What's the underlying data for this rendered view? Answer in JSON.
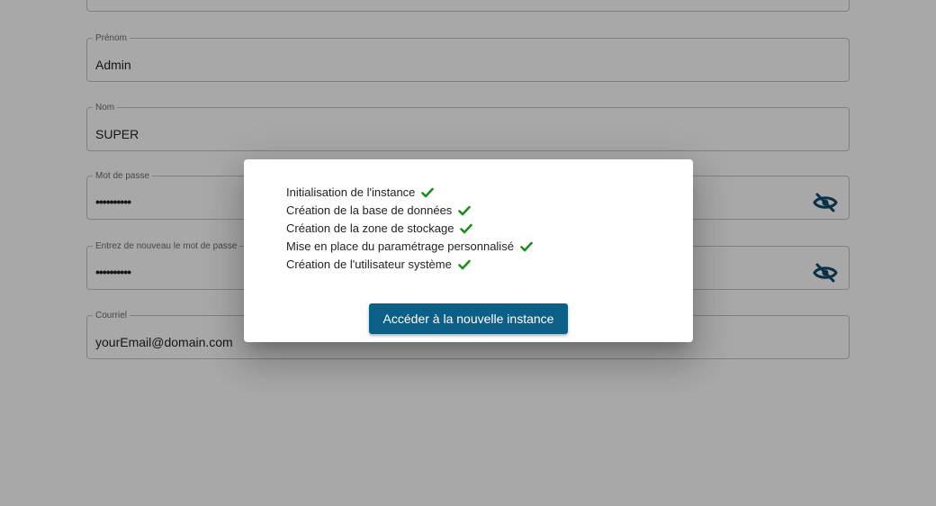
{
  "form": {
    "fields": [
      {
        "label": "",
        "value": ""
      },
      {
        "label": "Prénom",
        "value": "Admin"
      },
      {
        "label": "Nom",
        "value": "SUPER"
      },
      {
        "label": "Mot de passe",
        "value": "••••••••••"
      },
      {
        "label": "Entrez de nouveau le mot de passe",
        "value": "••••••••••"
      },
      {
        "label": "Courriel",
        "value": "yourEmail@domain.com"
      }
    ],
    "password_toggle_icon": "eye-off-icon"
  },
  "dialog": {
    "steps": [
      {
        "label": "Initialisation de l'instance",
        "status": "done"
      },
      {
        "label": "Création de la base de données",
        "status": "done"
      },
      {
        "label": "Création de la zone de stockage",
        "status": "done"
      },
      {
        "label": "Mise en place du paramétrage personnalisé",
        "status": "done"
      },
      {
        "label": "Création de l'utilisateur système",
        "status": "done"
      }
    ],
    "check_icon": "checkmark-icon",
    "button_label": "Accéder à la nouvelle instance"
  },
  "colors": {
    "primary": "#0c5f87",
    "success": "#1e8c1e",
    "overlay": "rgba(0,0,0,0.34)"
  }
}
